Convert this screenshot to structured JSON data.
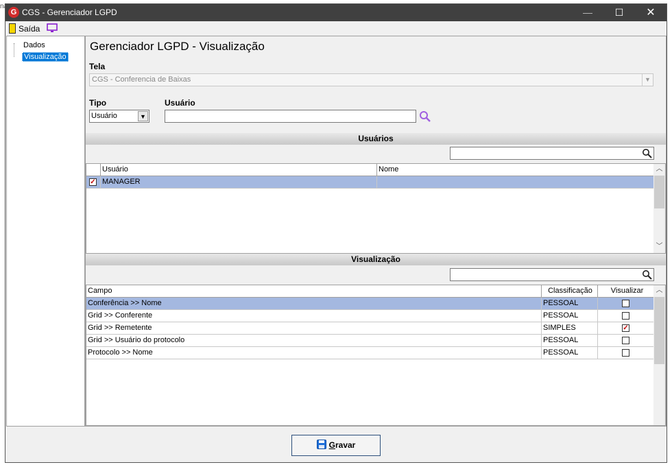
{
  "window": {
    "title": "CGS - Gerenciador LGPD",
    "logo_letter": "G",
    "minimize": "—",
    "maximize": "☐",
    "close": "✕"
  },
  "menu": {
    "exit_label": "Saída"
  },
  "tree": {
    "items": [
      {
        "label": "Dados"
      },
      {
        "label": "Visualização",
        "selected": true
      }
    ]
  },
  "main": {
    "page_title": "Gerenciador LGPD - Visualização",
    "tela": {
      "label": "Tela",
      "value": "CGS - Conferencia de Baixas"
    },
    "tipo": {
      "label": "Tipo",
      "value": "Usuário"
    },
    "usuario": {
      "label": "Usuário",
      "value": ""
    }
  },
  "usuarios_section": {
    "header": "Usuários",
    "search_value": "",
    "columns": [
      "Usuário",
      "Nome"
    ],
    "rows": [
      {
        "checked": true,
        "usuario": "MANAGER",
        "nome": "",
        "selected": true
      }
    ]
  },
  "visualizacao_section": {
    "header": "Visualização",
    "search_value": "",
    "columns": [
      "Campo",
      "Classificação",
      "Visualizar"
    ],
    "rows": [
      {
        "campo": "Conferência >> Nome",
        "classificacao": "PESSOAL",
        "visualizar": false,
        "selected": true
      },
      {
        "campo": "Grid >> Conferente",
        "classificacao": "PESSOAL",
        "visualizar": false
      },
      {
        "campo": "Grid >> Remetente",
        "classificacao": "SIMPLES",
        "visualizar": true
      },
      {
        "campo": "Grid >> Usuário do protocolo",
        "classificacao": "PESSOAL",
        "visualizar": false
      },
      {
        "campo": "Protocolo >> Nome",
        "classificacao": "PESSOAL",
        "visualizar": false
      }
    ]
  },
  "footer": {
    "save_first_letter": "G",
    "save_rest": "ravar"
  },
  "colors": {
    "selection": "#a4b8e0",
    "titlebar": "#404040",
    "tree_selected": "#0078d7",
    "check": "#c00000"
  }
}
